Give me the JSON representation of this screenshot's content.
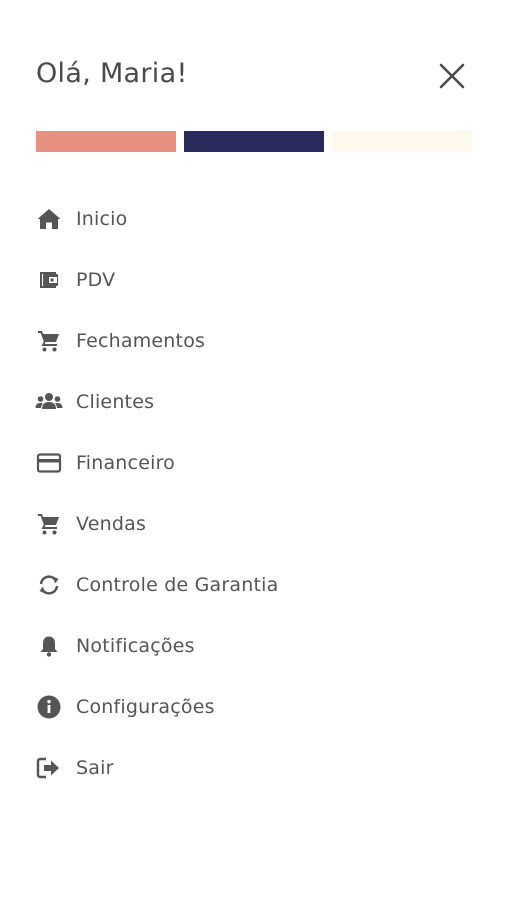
{
  "header": {
    "greeting": "Olá, Maria!",
    "close_icon": "close-icon"
  },
  "brand_stripes": [
    {
      "color": "#E8907F"
    },
    {
      "color": "#2B2A5C"
    },
    {
      "color": "#FDF9EC"
    }
  ],
  "menu": {
    "items": [
      {
        "label": "Inicio",
        "icon": "home-icon"
      },
      {
        "label": "PDV",
        "icon": "wallet-icon"
      },
      {
        "label": "Fechamentos",
        "icon": "cart-icon"
      },
      {
        "label": "Clientes",
        "icon": "users-icon"
      },
      {
        "label": "Financeiro",
        "icon": "credit-card-icon"
      },
      {
        "label": "Vendas",
        "icon": "cart-icon"
      },
      {
        "label": "Controle de Garantia",
        "icon": "sync-icon"
      },
      {
        "label": "Notificações",
        "icon": "bell-icon"
      },
      {
        "label": "Configurações",
        "icon": "info-icon"
      },
      {
        "label": "Sair",
        "icon": "logout-icon"
      }
    ]
  },
  "colors": {
    "icon": "#555555",
    "text": "#555555"
  }
}
